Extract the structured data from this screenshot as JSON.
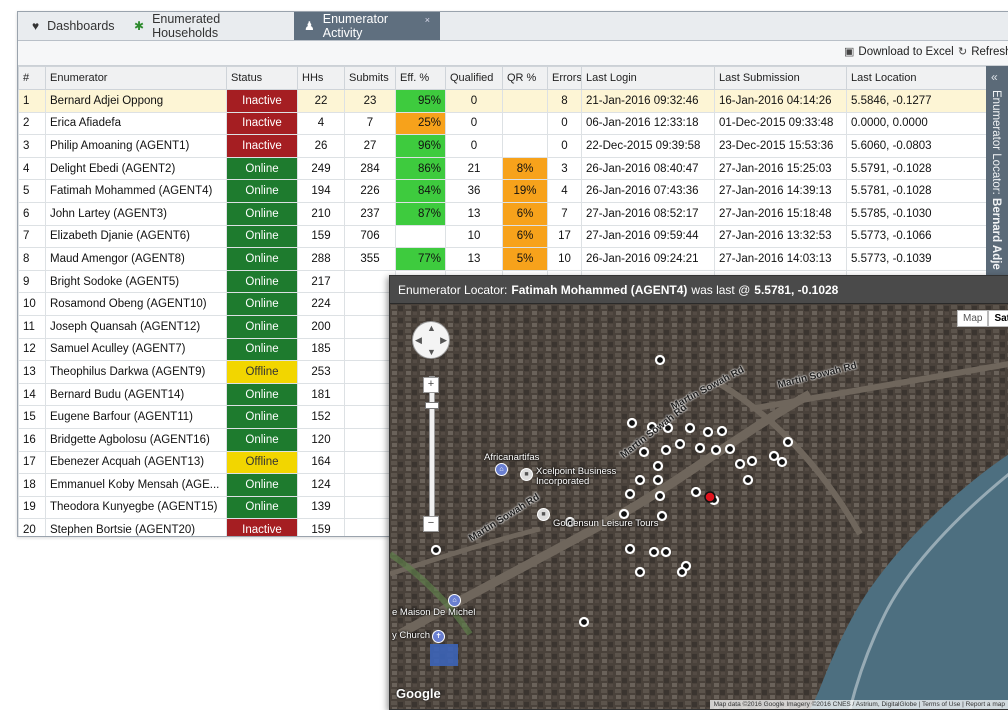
{
  "tabs": [
    {
      "label": "Dashboards",
      "icon": "dashboard-icon"
    },
    {
      "label": "Enumerated Households",
      "icon": "households-icon"
    },
    {
      "label": "Enumerator Activity",
      "icon": "person-icon",
      "close": "×"
    }
  ],
  "toolbar": {
    "download_label": "Download to Excel",
    "refresh_label": "Refresh"
  },
  "columns": [
    "#",
    "Enumerator",
    "Status",
    "HHs",
    "Submits",
    "Eff. %",
    "Qualified",
    "QR %",
    "Errors",
    "Last Login",
    "Last Submission",
    "Last Location"
  ],
  "rows": [
    {
      "n": "1",
      "name": "Bernard Adjei Oppong",
      "status": "Inactive",
      "hhs": "22",
      "submits": "23",
      "eff": "95%",
      "eff_level": "g",
      "qualified": "0",
      "qr": "",
      "errors": "8",
      "login": "21-Jan-2016 09:32:46",
      "submission": "16-Jan-2016 04:14:26",
      "location": "5.5846, -0.1277"
    },
    {
      "n": "2",
      "name": "Erica Afiadefa",
      "status": "Inactive",
      "hhs": "4",
      "submits": "7",
      "eff": "25%",
      "eff_level": "o",
      "qualified": "0",
      "qr": "",
      "errors": "0",
      "login": "06-Jan-2016 12:33:18",
      "submission": "01-Dec-2015 09:33:48",
      "location": "0.0000, 0.0000"
    },
    {
      "n": "3",
      "name": "Philip Amoaning (AGENT1)",
      "status": "Inactive",
      "hhs": "26",
      "submits": "27",
      "eff": "96%",
      "eff_level": "g",
      "qualified": "0",
      "qr": "",
      "errors": "0",
      "login": "22-Dec-2015 09:39:58",
      "submission": "23-Dec-2015 15:53:36",
      "location": "5.6060, -0.0803"
    },
    {
      "n": "4",
      "name": "Delight Ebedi (AGENT2)",
      "status": "Online",
      "hhs": "249",
      "submits": "284",
      "eff": "86%",
      "eff_level": "g",
      "qualified": "21",
      "qr": "8%",
      "errors": "3",
      "login": "26-Jan-2016 08:40:47",
      "submission": "27-Jan-2016 15:25:03",
      "location": "5.5791, -0.1028"
    },
    {
      "n": "5",
      "name": "Fatimah Mohammed (AGENT4)",
      "status": "Online",
      "hhs": "194",
      "submits": "226",
      "eff": "84%",
      "eff_level": "g",
      "qualified": "36",
      "qr": "19%",
      "errors": "4",
      "login": "26-Jan-2016 07:43:36",
      "submission": "27-Jan-2016 14:39:13",
      "location": "5.5781, -0.1028"
    },
    {
      "n": "6",
      "name": "John Lartey (AGENT3)",
      "status": "Online",
      "hhs": "210",
      "submits": "237",
      "eff": "87%",
      "eff_level": "g",
      "qualified": "13",
      "qr": "6%",
      "errors": "7",
      "login": "27-Jan-2016 08:52:17",
      "submission": "27-Jan-2016 15:18:48",
      "location": "5.5785, -0.1030"
    },
    {
      "n": "7",
      "name": "Elizabeth Djanie (AGENT6)",
      "status": "Online",
      "hhs": "159",
      "submits": "706",
      "eff": "",
      "eff_level": "",
      "qualified": "10",
      "qr": "6%",
      "errors": "17",
      "login": "27-Jan-2016 09:59:44",
      "submission": "27-Jan-2016 13:32:53",
      "location": "5.5773, -0.1066"
    },
    {
      "n": "8",
      "name": "Maud Amengor (AGENT8)",
      "status": "Online",
      "hhs": "288",
      "submits": "355",
      "eff": "77%",
      "eff_level": "g",
      "qualified": "13",
      "qr": "5%",
      "errors": "10",
      "login": "26-Jan-2016 09:24:21",
      "submission": "27-Jan-2016 14:03:13",
      "location": "5.5773, -0.1039"
    },
    {
      "n": "9",
      "name": "Bright Sodoke (AGENT5)",
      "status": "Online",
      "hhs": "217",
      "submits": "",
      "eff": "",
      "eff_level": "",
      "qualified": "",
      "qr": "",
      "errors": "",
      "login": "",
      "submission": "",
      "location": ""
    },
    {
      "n": "10",
      "name": "Rosamond Obeng (AGENT10)",
      "status": "Online",
      "hhs": "224",
      "submits": "",
      "eff": "",
      "eff_level": "",
      "qualified": "",
      "qr": "",
      "errors": "",
      "login": "",
      "submission": "",
      "location": ""
    },
    {
      "n": "11",
      "name": "Joseph Quansah (AGENT12)",
      "status": "Online",
      "hhs": "200",
      "submits": "",
      "eff": "",
      "eff_level": "",
      "qualified": "",
      "qr": "",
      "errors": "",
      "login": "",
      "submission": "",
      "location": ""
    },
    {
      "n": "12",
      "name": "Samuel Aculley (AGENT7)",
      "status": "Online",
      "hhs": "185",
      "submits": "",
      "eff": "",
      "eff_level": "",
      "qualified": "",
      "qr": "",
      "errors": "",
      "login": "",
      "submission": "",
      "location": ""
    },
    {
      "n": "13",
      "name": "Theophilus Darkwa (AGENT9)",
      "status": "Offline",
      "hhs": "253",
      "submits": "",
      "eff": "",
      "eff_level": "",
      "qualified": "",
      "qr": "",
      "errors": "",
      "login": "",
      "submission": "",
      "location": ""
    },
    {
      "n": "14",
      "name": "Bernard Budu (AGENT14)",
      "status": "Online",
      "hhs": "181",
      "submits": "",
      "eff": "",
      "eff_level": "",
      "qualified": "",
      "qr": "",
      "errors": "",
      "login": "",
      "submission": "",
      "location": ""
    },
    {
      "n": "15",
      "name": "Eugene Barfour (AGENT11)",
      "status": "Online",
      "hhs": "152",
      "submits": "",
      "eff": "",
      "eff_level": "",
      "qualified": "",
      "qr": "",
      "errors": "",
      "login": "",
      "submission": "",
      "location": ""
    },
    {
      "n": "16",
      "name": "Bridgette Agbolosu (AGENT16)",
      "status": "Online",
      "hhs": "120",
      "submits": "",
      "eff": "",
      "eff_level": "",
      "qualified": "",
      "qr": "",
      "errors": "",
      "login": "",
      "submission": "",
      "location": ""
    },
    {
      "n": "17",
      "name": "Ebenezer Acquah (AGENT13)",
      "status": "Offline",
      "hhs": "164",
      "submits": "",
      "eff": "",
      "eff_level": "",
      "qualified": "",
      "qr": "",
      "errors": "",
      "login": "",
      "submission": "",
      "location": ""
    },
    {
      "n": "18",
      "name": "Emmanuel Koby Mensah (AGE...",
      "status": "Online",
      "hhs": "124",
      "submits": "",
      "eff": "",
      "eff_level": "",
      "qualified": "",
      "qr": "",
      "errors": "",
      "login": "",
      "submission": "",
      "location": ""
    },
    {
      "n": "19",
      "name": "Theodora Kunyegbe (AGENT15)",
      "status": "Online",
      "hhs": "139",
      "submits": "",
      "eff": "",
      "eff_level": "",
      "qualified": "",
      "qr": "",
      "errors": "",
      "login": "",
      "submission": "",
      "location": ""
    },
    {
      "n": "20",
      "name": "Stephen Bortsie (AGENT20)",
      "status": "Inactive",
      "hhs": "159",
      "submits": "",
      "eff": "",
      "eff_level": "",
      "qualified": "",
      "qr": "",
      "errors": "",
      "login": "",
      "submission": "",
      "location": ""
    }
  ],
  "side_panel": {
    "label": "Enumerator Locator:",
    "name": "Bernard Adje",
    "collapse": "«"
  },
  "map": {
    "title_prefix": "Enumerator Locator:",
    "title_name": "Fatimah Mohammed (AGENT4)",
    "title_mid": "was last @",
    "title_coord": "5.5781, -0.1028",
    "type_map": "Map",
    "type_satellite": "Satel",
    "labels": [
      "Africanartifas",
      "Xcelpoint Business",
      "Incorporated",
      "Goldensun Leisure Tours",
      "e Maison De Michel",
      "y Church"
    ],
    "roads": [
      "Martin Sowah Rd",
      "Martin Sowah Rd",
      "Martin Sowah Rd",
      "Martin Sowah Rd"
    ],
    "logo": "Google",
    "attribution": "Map data ©2016 Google Imagery ©2016 CNES / Astrium, DigitalGlobe | Terms of Use | Report a map",
    "colors": {
      "marker": "#ffffff",
      "selected_marker": "#e0141e",
      "sea": "#4d6f80"
    }
  },
  "colors": {
    "online": "#1e7b2e",
    "inactive": "#a51e22",
    "offline": "#f2d600",
    "eff_green": "#3ecb3e",
    "eff_orange": "#f7a21b",
    "selected_row": "#fdf5d5"
  }
}
